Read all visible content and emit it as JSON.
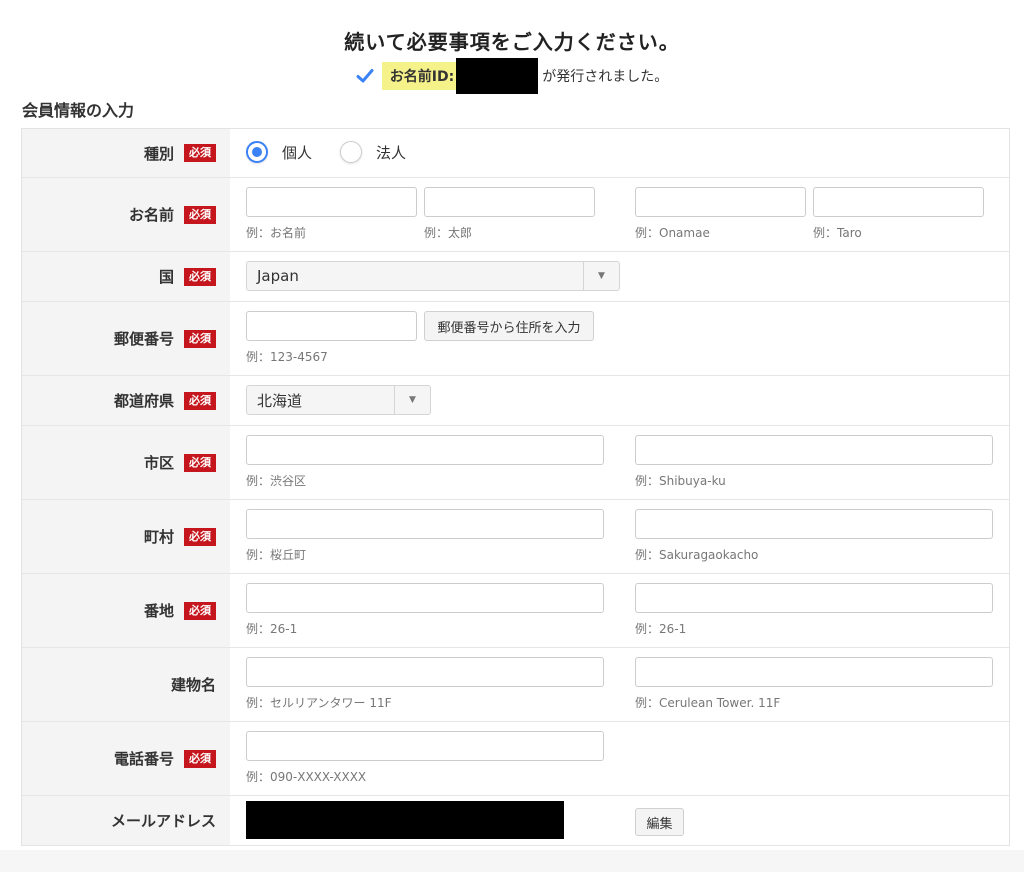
{
  "header": {
    "title": "続いて必要事項をご入力ください。",
    "id_label": "お名前ID:",
    "id_suffix": "が発行されました。",
    "check_color": "#3b82f6",
    "highlight_color": "#f6f28a"
  },
  "section_title": "会員情報の入力",
  "required_badge": "必須",
  "rows": {
    "type": {
      "label": "種別",
      "options": [
        "個人",
        "法人"
      ],
      "selected": "個人"
    },
    "name": {
      "label": "お名前",
      "hints": [
        "例：お名前",
        "例：太郎",
        "例：Onamae",
        "例：Taro"
      ]
    },
    "country": {
      "label": "国",
      "value": "Japan"
    },
    "postal": {
      "label": "郵便番号",
      "hint": "例：123-4567",
      "button": "郵便番号から住所を入力"
    },
    "prefecture": {
      "label": "都道府県",
      "value": "北海道"
    },
    "city": {
      "label": "市区",
      "hints": [
        "例：渋谷区",
        "例：Shibuya-ku"
      ]
    },
    "town": {
      "label": "町村",
      "hints": [
        "例：桜丘町",
        "例：Sakuragaokacho"
      ]
    },
    "block": {
      "label": "番地",
      "hints": [
        "例：26-1",
        "例：26-1"
      ]
    },
    "building": {
      "label": "建物名",
      "hints": [
        "例：セルリアンタワー 11F",
        "例：Cerulean Tower. 11F"
      ]
    },
    "phone": {
      "label": "電話番号",
      "hint": "例：090-XXXX-XXXX"
    },
    "email": {
      "label": "メールアドレス",
      "button": "編集"
    }
  },
  "colors": {
    "required_bg": "#c4161c",
    "accent": "#3b82f6",
    "label_bg": "#f4f4f4"
  }
}
